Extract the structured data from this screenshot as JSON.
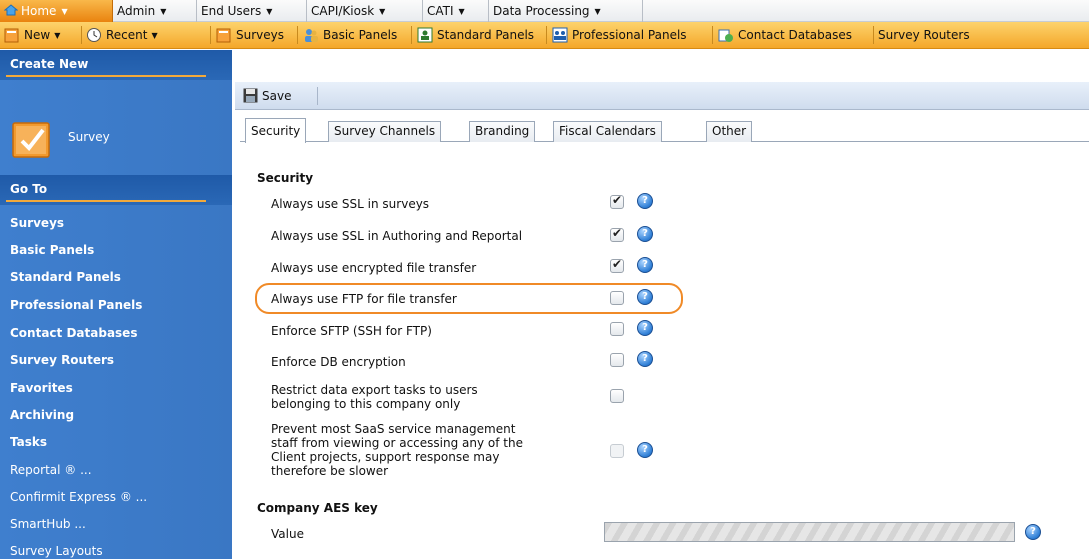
{
  "menubar": {
    "items": [
      {
        "label": "Home",
        "active": true
      },
      {
        "label": "Admin"
      },
      {
        "label": "End Users"
      },
      {
        "label": "CAPI/Kiosk"
      },
      {
        "label": "CATI"
      },
      {
        "label": "Data Processing"
      }
    ]
  },
  "toolbar": {
    "new_label": "New",
    "recent_label": "Recent",
    "surveys_label": "Surveys",
    "basic_panels_label": "Basic Panels",
    "standard_panels_label": "Standard Panels",
    "professional_panels_label": "Professional Panels",
    "contact_databases_label": "Contact Databases",
    "survey_routers_label": "Survey Routers"
  },
  "sidebar": {
    "create_new_header": "Create New",
    "survey_label": "Survey",
    "goto_header": "Go To",
    "items": [
      {
        "label": "Surveys"
      },
      {
        "label": "Basic Panels"
      },
      {
        "label": "Standard Panels"
      },
      {
        "label": "Professional Panels"
      },
      {
        "label": "Contact Databases"
      },
      {
        "label": "Survey Routers"
      },
      {
        "label": "Favorites"
      },
      {
        "label": "Archiving"
      },
      {
        "label": "Tasks"
      },
      {
        "label": "Reportal ® ..."
      },
      {
        "label": "Confirmit Express ® ..."
      },
      {
        "label": "SmartHub ..."
      },
      {
        "label": "Survey Layouts"
      }
    ]
  },
  "main": {
    "save_label": "Save",
    "tabs": [
      {
        "label": "Security",
        "active": true
      },
      {
        "label": "Survey Channels"
      },
      {
        "label": "Branding"
      },
      {
        "label": "Fiscal Calendars"
      },
      {
        "label": "Other"
      }
    ],
    "security_title": "Security",
    "settings": [
      {
        "label": "Always use SSL in surveys",
        "checked": true,
        "help": true
      },
      {
        "label": "Always use SSL in Authoring and Reportal",
        "checked": true,
        "help": true
      },
      {
        "label": "Always use encrypted file transfer",
        "checked": true,
        "help": true
      },
      {
        "label": "Always use FTP for file transfer",
        "checked": false,
        "help": true,
        "highlighted": true
      },
      {
        "label": "Enforce SFTP (SSH for FTP)",
        "checked": false,
        "help": true
      },
      {
        "label": "Enforce DB encryption",
        "checked": false,
        "help": true
      },
      {
        "label_lines": [
          "Restrict data export tasks to users",
          "belonging to this company only"
        ],
        "checked": false,
        "help": false
      },
      {
        "label_lines": [
          "Prevent most SaaS service management",
          "staff from viewing or accessing any of the",
          "Client projects, support response may",
          "therefore be slower"
        ],
        "checked": false,
        "disabled": true,
        "help": true
      }
    ],
    "aes_title": "Company AES key",
    "aes_value_label": "Value",
    "help_glyph": "?"
  },
  "colors": {
    "accent_orange": "#f08a27",
    "toolbar_orange": "#f4a72a",
    "sidebar_blue": "#3a77c4"
  }
}
